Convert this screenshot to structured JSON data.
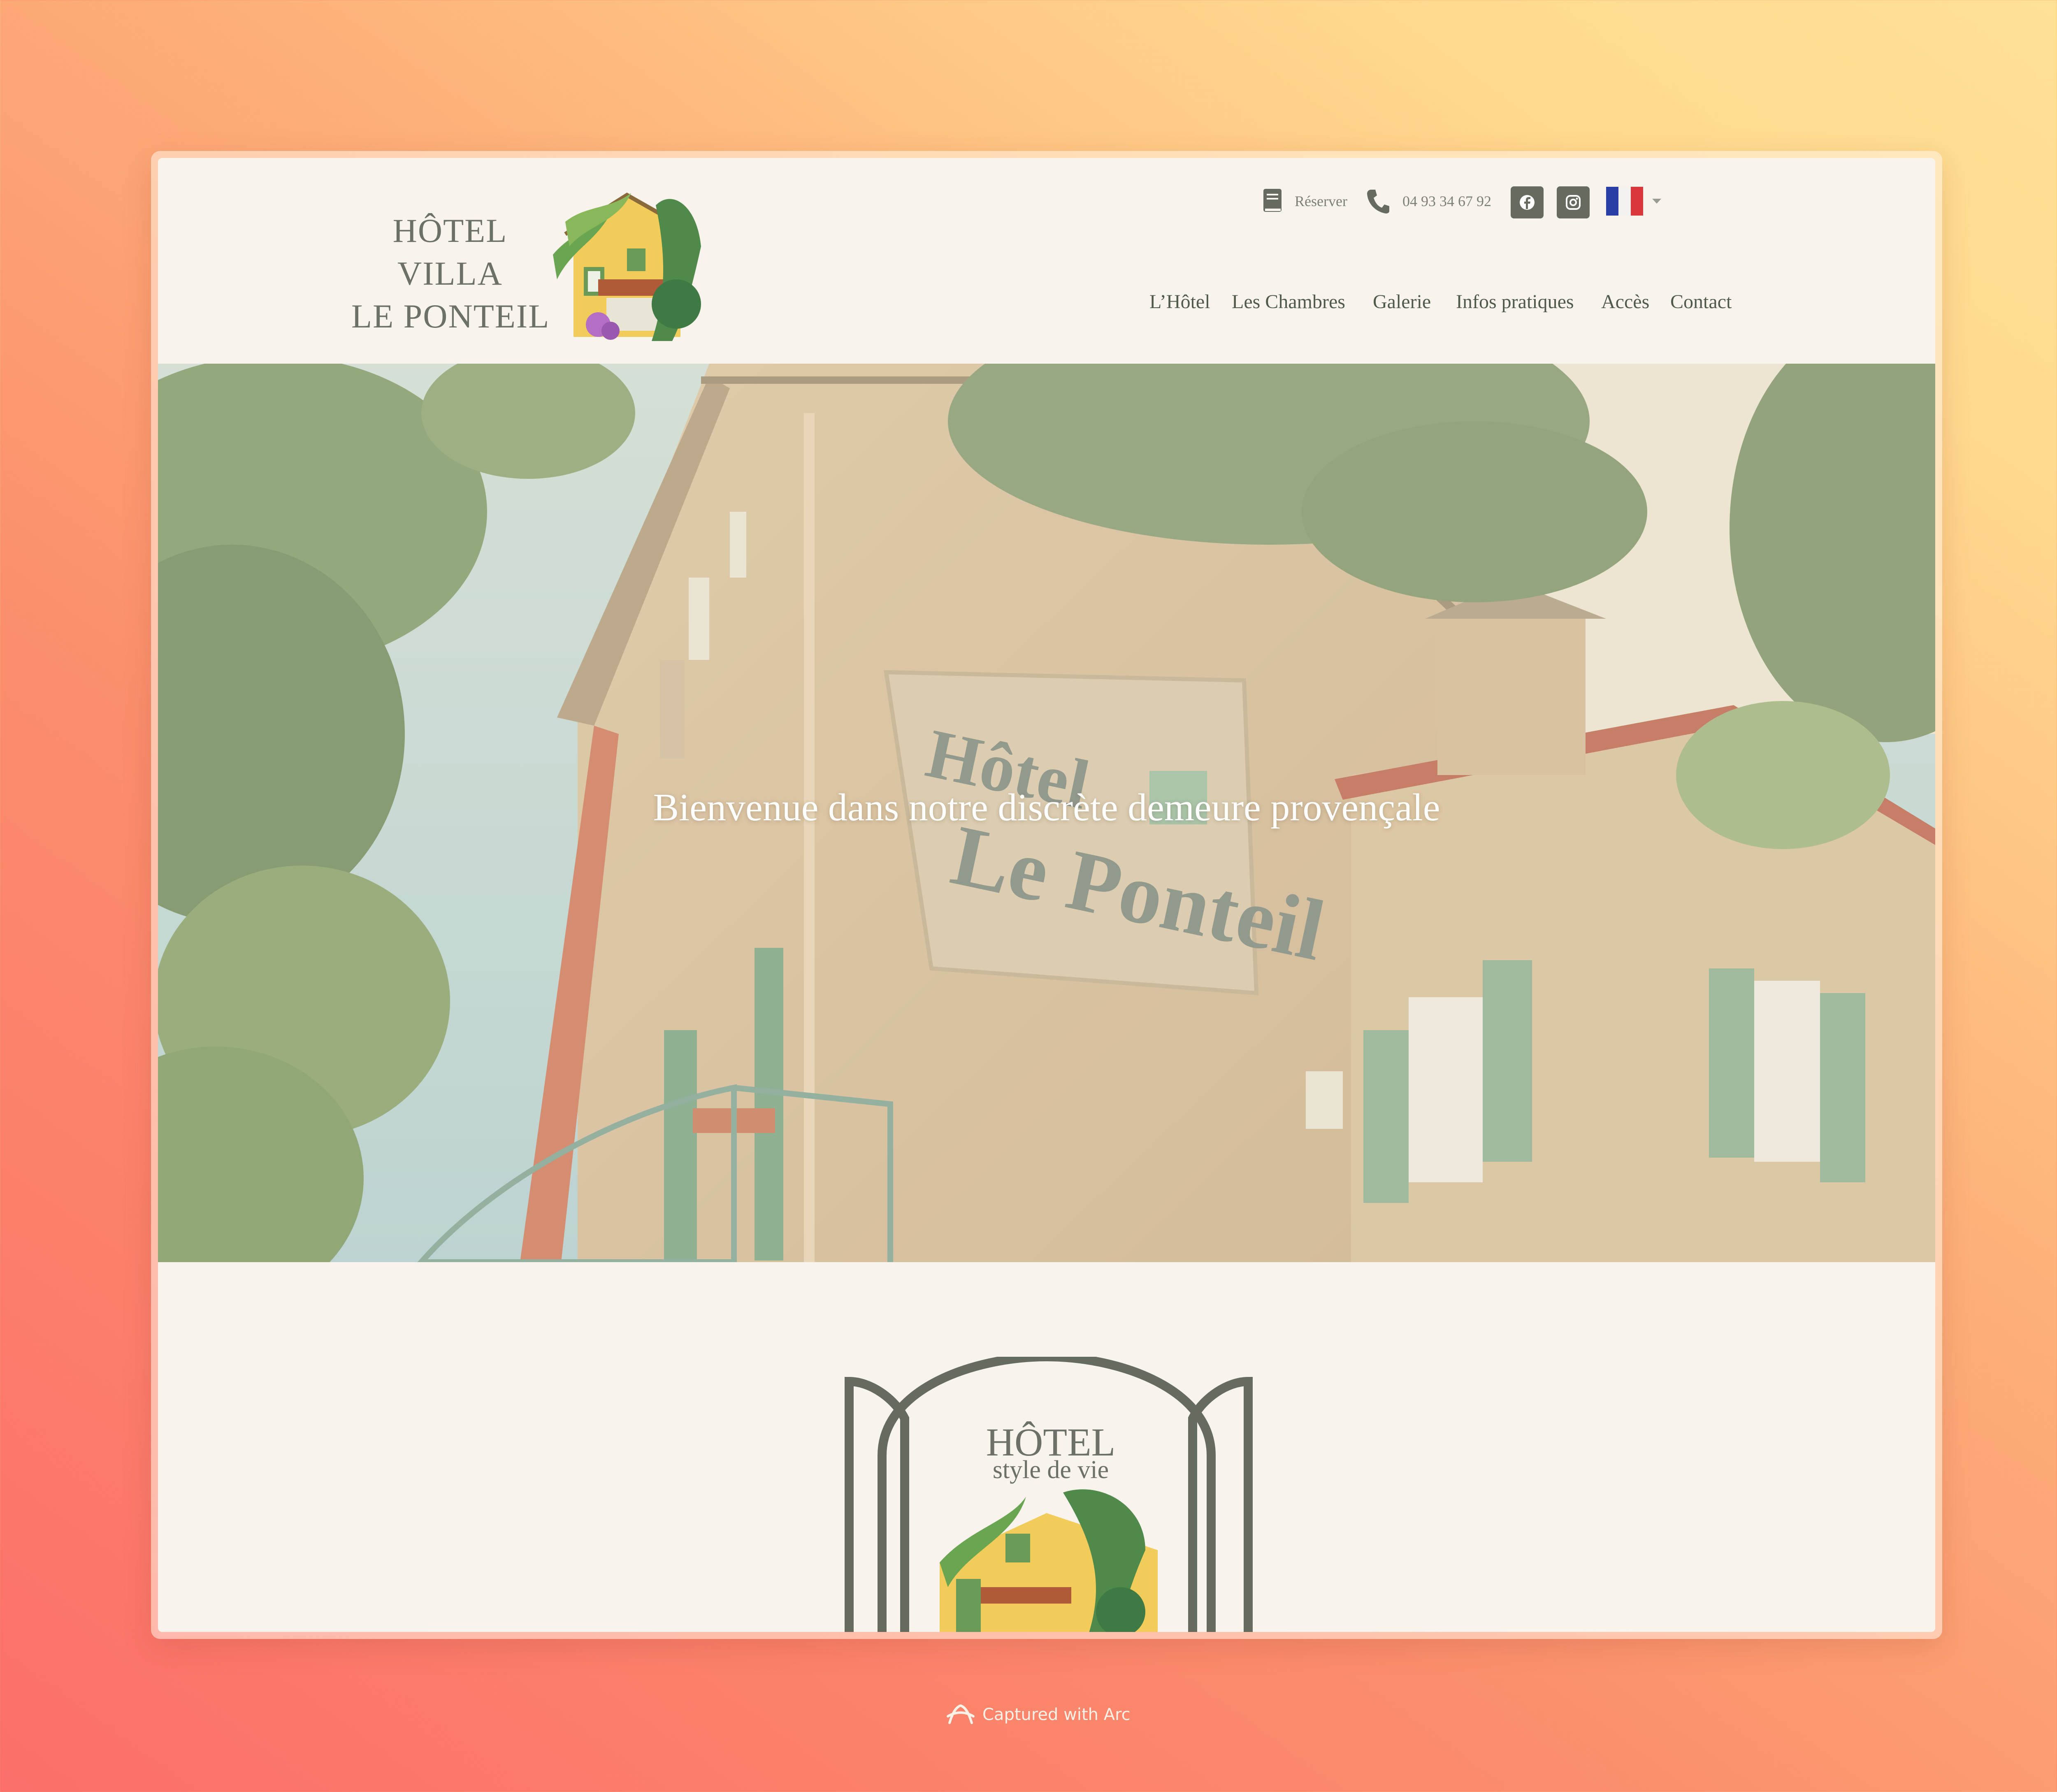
{
  "header": {
    "brand": {
      "line1": "HÔTEL",
      "line2": "VILLA",
      "line3": "LE PONTEIL"
    },
    "utility": {
      "reserve_label": "Réserver",
      "phone": "04 93 34 67 92",
      "reserve_icon": "book-icon",
      "phone_icon": "phone-icon",
      "social": [
        "facebook-icon",
        "instagram-icon"
      ],
      "language_icon": "french-flag-icon"
    },
    "nav": [
      {
        "label": "L’Hôtel"
      },
      {
        "label": "Les Chambres"
      },
      {
        "label": "Galerie"
      },
      {
        "label": "Infos pratiques"
      },
      {
        "label": "Accès"
      },
      {
        "label": "Contact"
      }
    ]
  },
  "hero": {
    "title": "Bienvenue dans notre discrète demeure provençale",
    "sign_text_1": "Hôtel",
    "sign_text_2": "Le Ponteil"
  },
  "section": {
    "logo_title": "HÔTEL",
    "logo_subtitle": "style de vie"
  },
  "capture": {
    "label": "Captured with Arc"
  },
  "colors": {
    "accent": "#656b5f",
    "nav_text": "#4f5a4a",
    "page_bg": "#f8f3ec"
  }
}
